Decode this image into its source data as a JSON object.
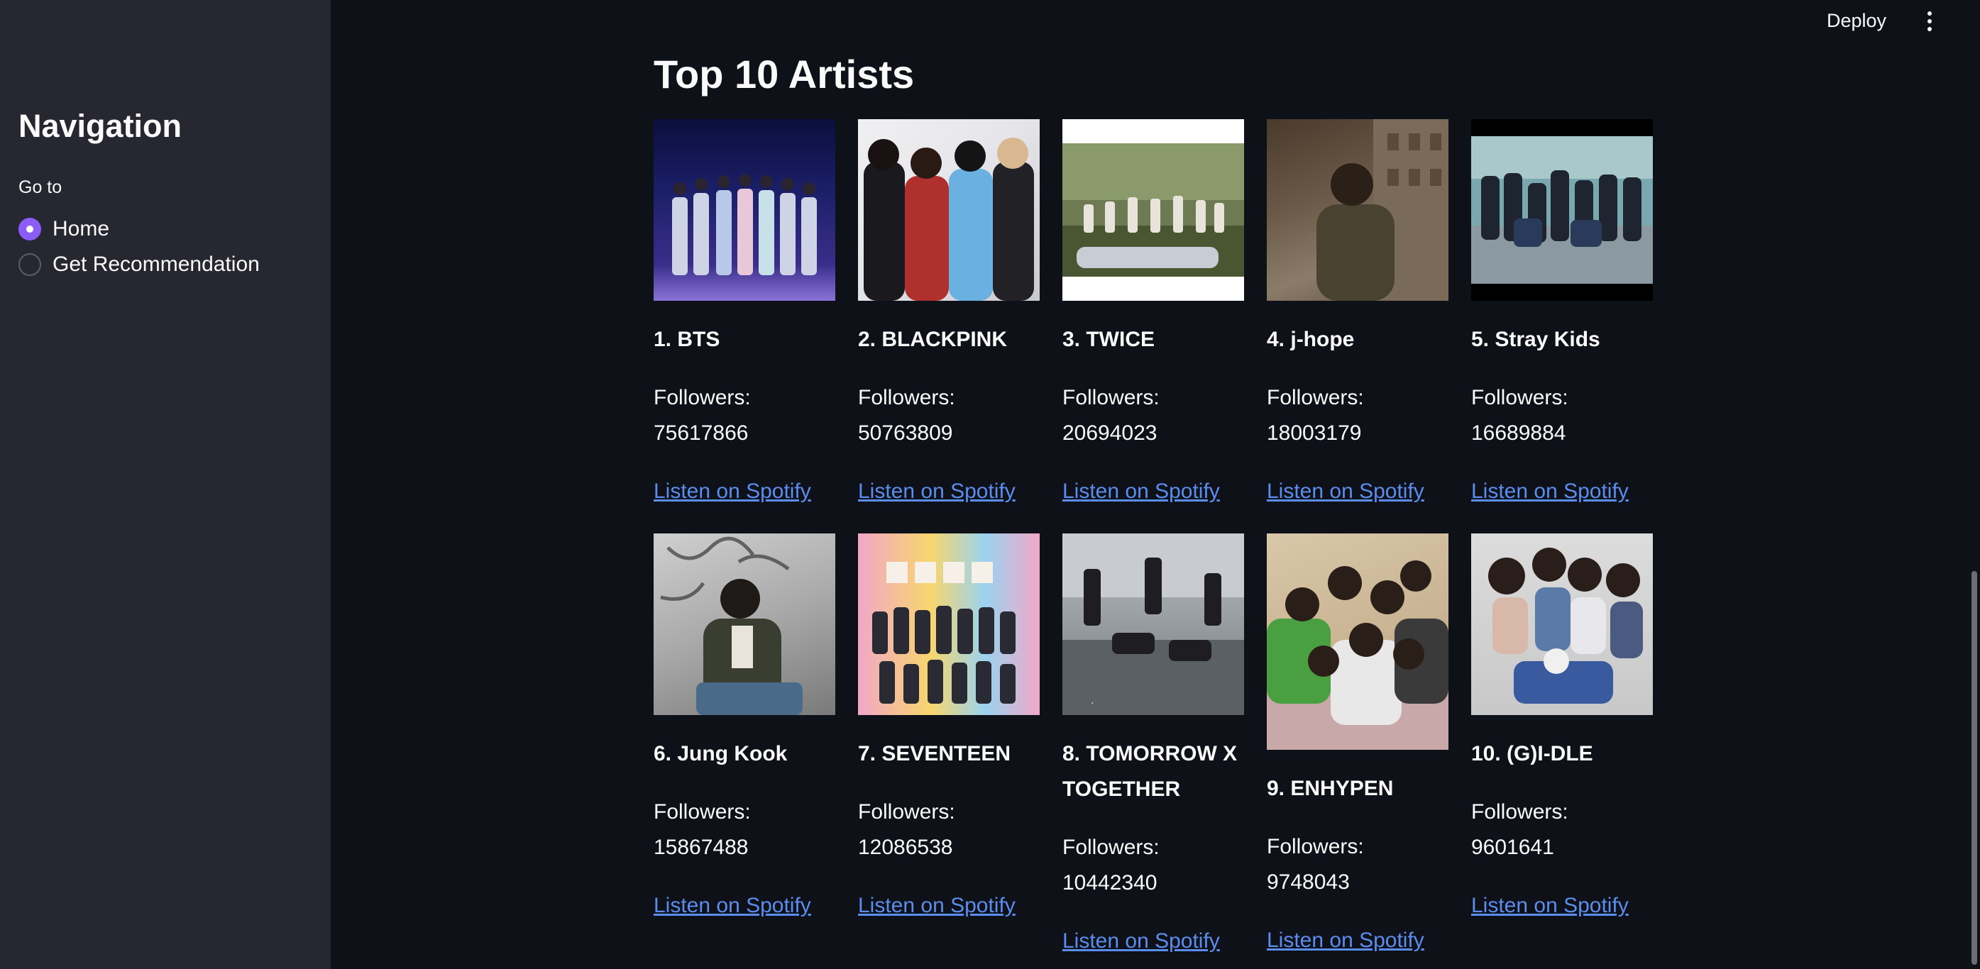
{
  "header": {
    "deploy_label": "Deploy",
    "menu_icon": "vertical-ellipsis-icon"
  },
  "sidebar": {
    "title": "Navigation",
    "goto_label": "Go to",
    "options": [
      {
        "label": "Home",
        "selected": true
      },
      {
        "label": "Get Recommendation",
        "selected": false
      }
    ]
  },
  "main": {
    "title": "Top 10 Artists",
    "artists": [
      {
        "name": "1. BTS",
        "followers": "Followers: 75617866",
        "link": "Listen on Spotify"
      },
      {
        "name": "2. BLACKPINK",
        "followers": "Followers: 50763809",
        "link": "Listen on Spotify"
      },
      {
        "name": "3. TWICE",
        "followers": "Followers: 20694023",
        "link": "Listen on Spotify"
      },
      {
        "name": "4. j-hope",
        "followers": "Followers: 18003179",
        "link": "Listen on Spotify"
      },
      {
        "name": "5. Stray Kids",
        "followers": "Followers: 16689884",
        "link": "Listen on Spotify"
      },
      {
        "name": "6. Jung Kook",
        "followers": "Followers: 15867488",
        "link": "Listen on Spotify"
      },
      {
        "name": "7. SEVENTEEN",
        "followers": "Followers: 12086538",
        "link": "Listen on Spotify"
      },
      {
        "name": "8. TOMORROW X TOGETHER",
        "followers": "Followers: 10442340",
        "link": "Listen on Spotify"
      },
      {
        "name": "9. ENHYPEN",
        "followers": "Followers: 9748043",
        "link": "Listen on Spotify"
      },
      {
        "name": "10. (G)I-DLE",
        "followers": "Followers: 9601641",
        "link": "Listen on Spotify"
      }
    ]
  },
  "colors": {
    "background": "#0e1117",
    "sidebar": "#262730",
    "accent": "#8b5cf6",
    "link": "#5b8def",
    "text": "#fafafa"
  }
}
